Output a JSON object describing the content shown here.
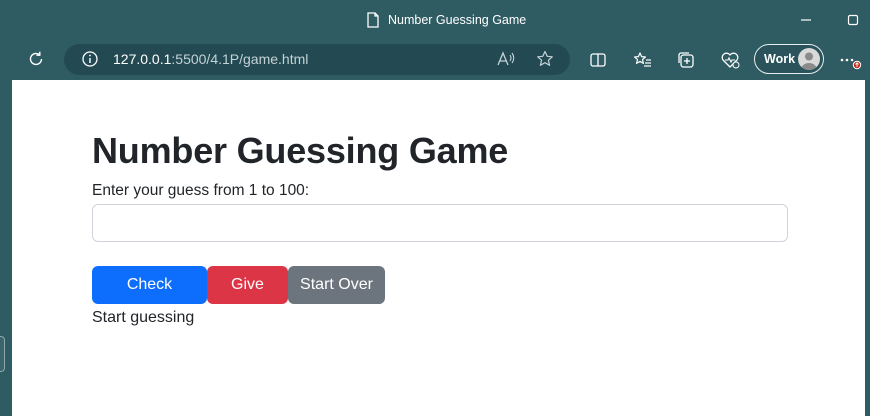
{
  "window": {
    "title": "Number Guessing Game",
    "minimize_glyph": "—",
    "maximize_glyph": "▢"
  },
  "toolbar": {
    "url_host": "127.0.0.1",
    "url_path": ":5500/4.1P/game.html",
    "profile_label": "Work",
    "icons": [
      "refresh-icon",
      "info-icon",
      "read-aloud-icon",
      "favorite-star-icon",
      "split-screen-icon",
      "favorites-icon",
      "collections-icon",
      "browser-essentials-icon",
      "more-icon"
    ]
  },
  "page": {
    "heading": "Number Guessing Game",
    "prompt": "Enter your guess from 1 to 100:",
    "guess_value": "",
    "buttons": {
      "check": "Check Guess",
      "give_up": "Give Up",
      "start_over": "Start Over"
    },
    "status": "Start guessing"
  },
  "colors": {
    "chrome_bg": "#2f5b63",
    "primary": "#0d6efd",
    "danger": "#dc3545",
    "secondary": "#6c757d"
  }
}
